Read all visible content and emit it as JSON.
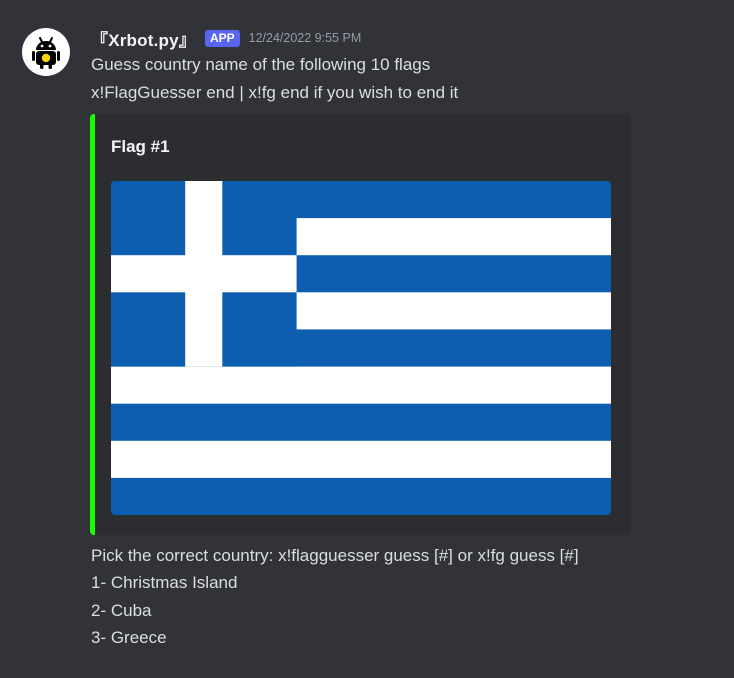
{
  "message": {
    "author": "『Xrbot.py』",
    "badge": "APP",
    "timestamp": "12/24/2022 9:55 PM",
    "lines": [
      "Guess country name of the following 10 flags",
      "x!FlagGuesser end | x!fg end if you wish to end it"
    ]
  },
  "embed": {
    "title": "Flag #1",
    "accent_color": "#1aff00",
    "image": {
      "icon": "flag-greece-image",
      "colors": {
        "blue": "#0d5eaf",
        "white": "#ffffff"
      }
    }
  },
  "footer_lines": [
    "Pick the correct country: x!flagguesser guess [#] or x!fg guess [#]",
    "1- Christmas Island",
    "2- Cuba",
    "3- Greece"
  ]
}
